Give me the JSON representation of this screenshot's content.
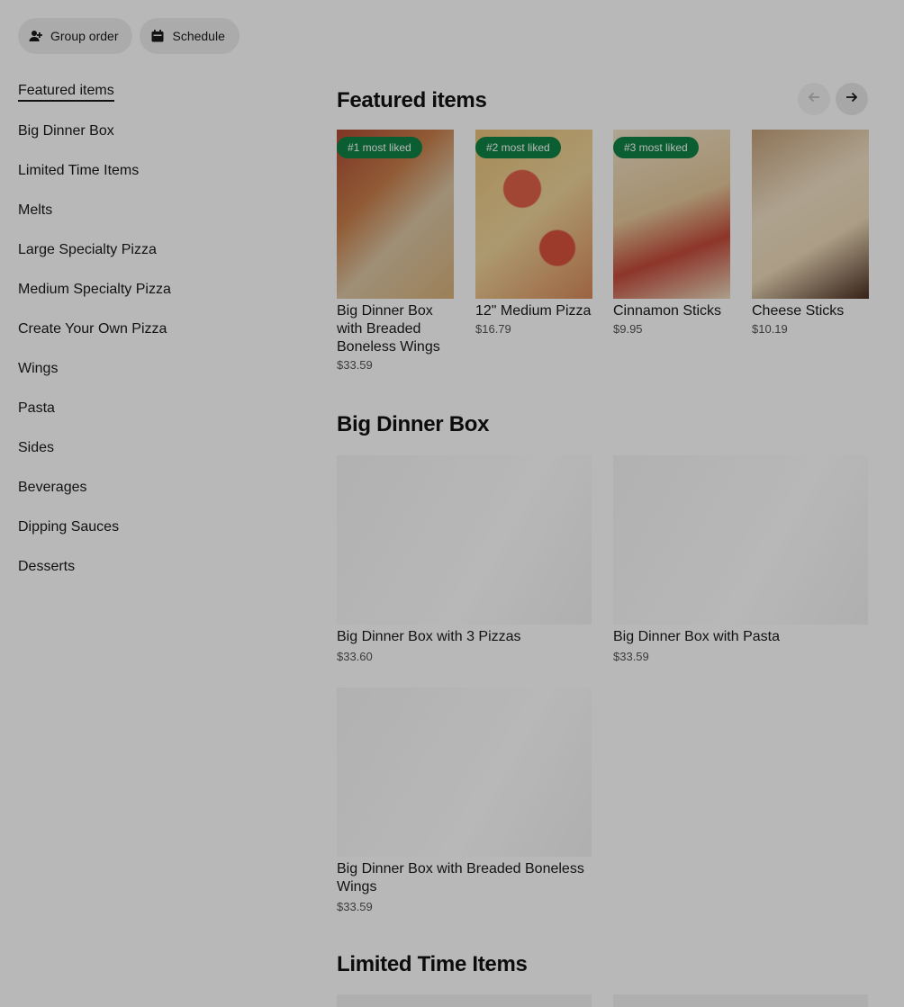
{
  "top_actions": {
    "group_order_label": "Group order",
    "schedule_label": "Schedule"
  },
  "sidebar": {
    "items": [
      {
        "label": "Featured items",
        "active": true
      },
      {
        "label": "Big Dinner Box"
      },
      {
        "label": "Limited Time Items"
      },
      {
        "label": "Melts"
      },
      {
        "label": "Large Specialty Pizza"
      },
      {
        "label": "Medium Specialty Pizza"
      },
      {
        "label": "Create Your Own Pizza"
      },
      {
        "label": "Wings"
      },
      {
        "label": "Pasta"
      },
      {
        "label": "Sides"
      },
      {
        "label": "Beverages"
      },
      {
        "label": "Dipping Sauces"
      },
      {
        "label": "Desserts"
      }
    ]
  },
  "featured": {
    "title": "Featured items",
    "prev_icon": "arrow-left-icon",
    "next_icon": "arrow-right-icon",
    "items": [
      {
        "badge": "#1 most liked",
        "name": "Big Dinner Box with Breaded Boneless Wings",
        "price": "$33.59"
      },
      {
        "badge": "#2 most liked",
        "name": "12\" Medium Pizza",
        "price": "$16.79"
      },
      {
        "badge": "#3 most liked",
        "name": "Cinnamon Sticks",
        "price": "$9.95"
      },
      {
        "name": "Cheese Sticks",
        "price": "$10.19"
      }
    ]
  },
  "big_dinner_box": {
    "title": "Big Dinner Box",
    "items": [
      {
        "name": "Big Dinner Box with 3 Pizzas",
        "price": "$33.60"
      },
      {
        "name": "Big Dinner Box with Pasta",
        "price": "$33.59"
      },
      {
        "name": "Big Dinner Box with Breaded Boneless Wings",
        "price": "$33.59"
      }
    ]
  },
  "limited_time": {
    "title": "Limited Time Items"
  },
  "colors": {
    "badge": "#0e8345",
    "pill_bg": "#eeeeee",
    "overlay": "rgba(0,0,0,0.28)"
  }
}
